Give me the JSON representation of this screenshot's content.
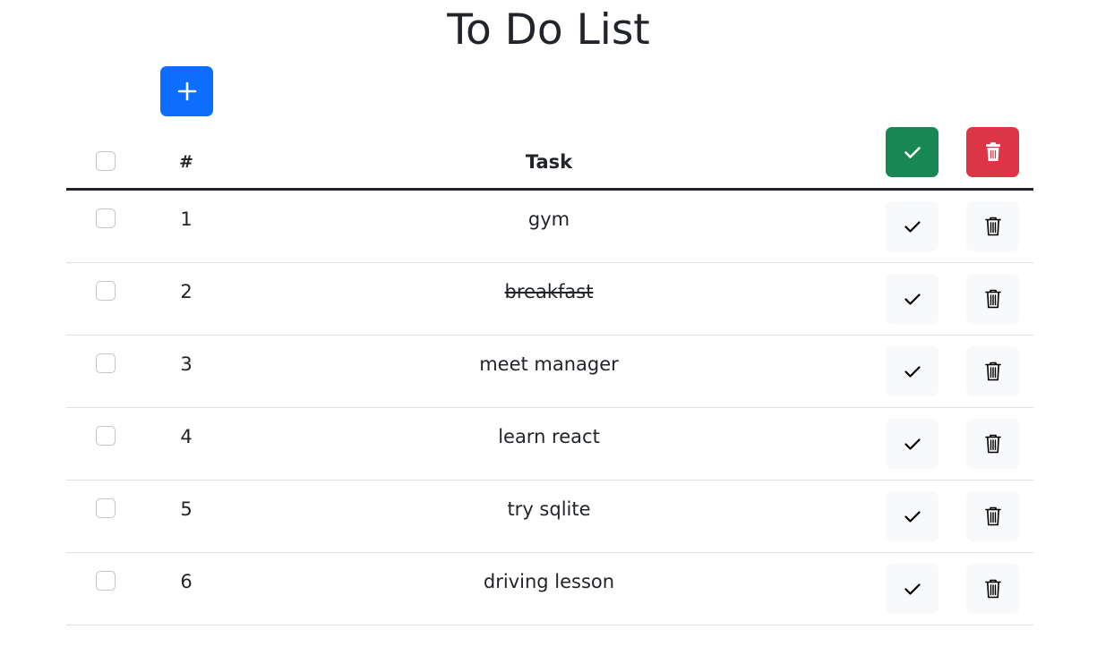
{
  "title": "To Do List",
  "icons": {
    "add": "plus-icon",
    "complete": "check-icon",
    "delete": "trash-icon"
  },
  "colors": {
    "primary": "#0d6efd",
    "success": "#198754",
    "danger": "#dc3545",
    "light": "#f8f9fa",
    "text": "#212529"
  },
  "table": {
    "headers": {
      "number": "#",
      "task": "Task"
    },
    "rows": [
      {
        "number": "1",
        "task": "gym",
        "done": false
      },
      {
        "number": "2",
        "task": "breakfast",
        "done": true
      },
      {
        "number": "3",
        "task": "meet manager",
        "done": false
      },
      {
        "number": "4",
        "task": "learn react",
        "done": false
      },
      {
        "number": "5",
        "task": "try sqlite",
        "done": false
      },
      {
        "number": "6",
        "task": "driving lesson",
        "done": false
      }
    ]
  }
}
